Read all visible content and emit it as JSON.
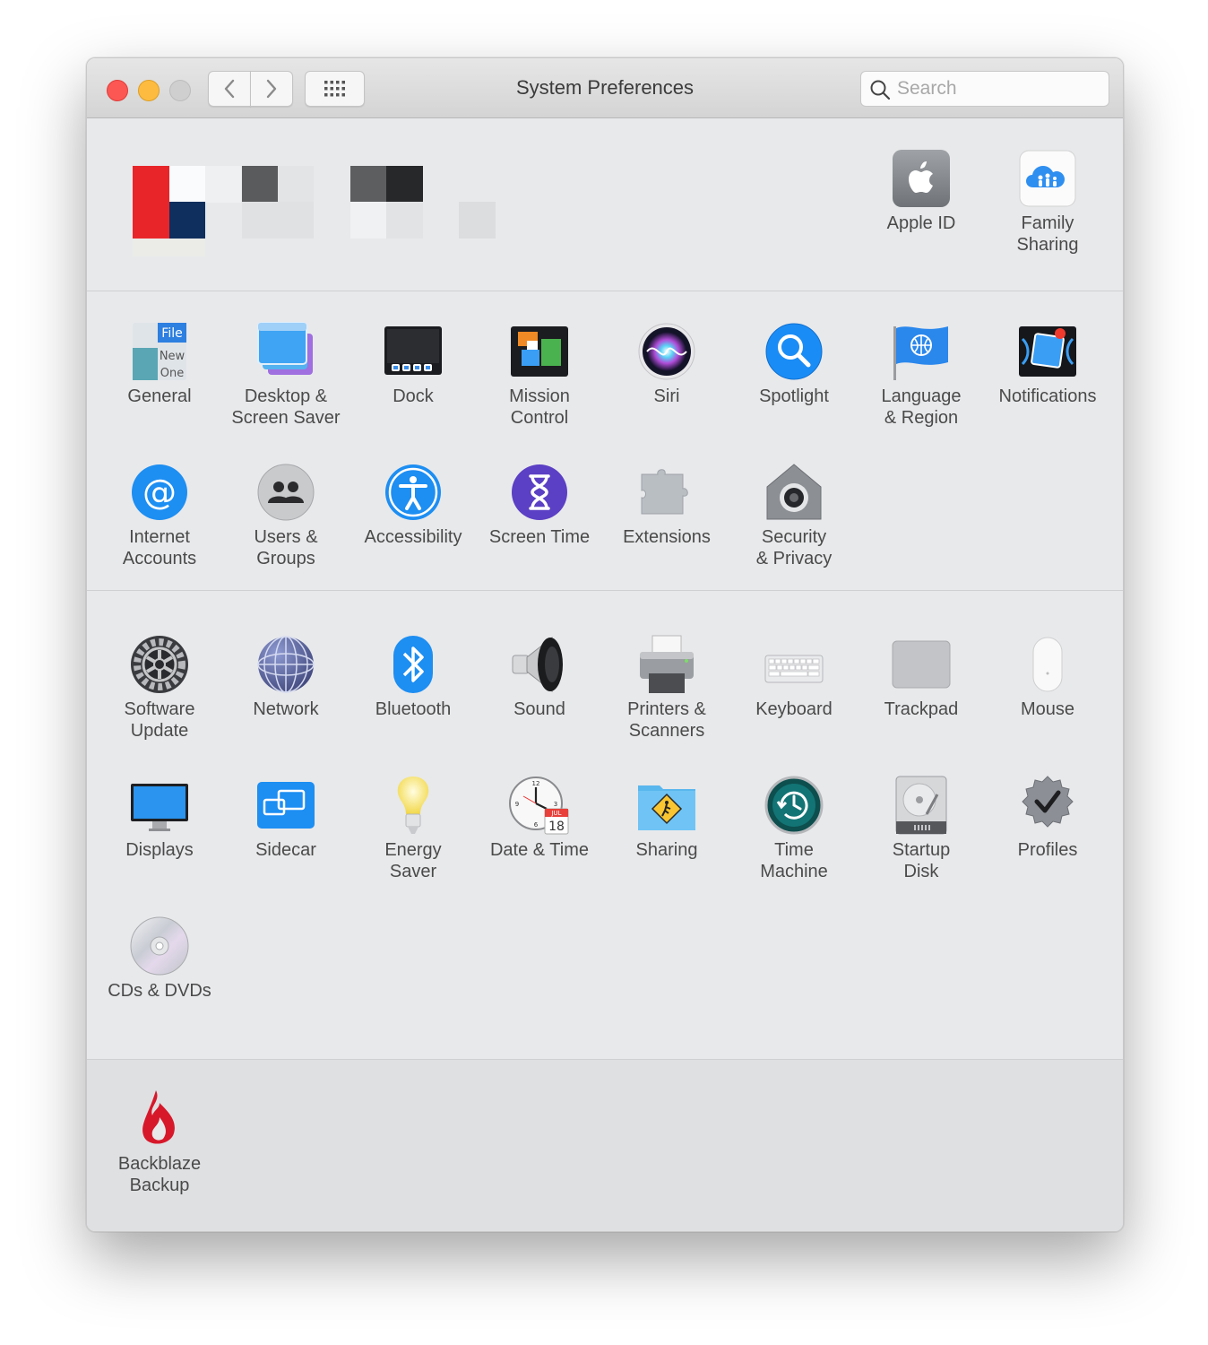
{
  "window": {
    "title": "System Preferences"
  },
  "search": {
    "placeholder": "Search"
  },
  "account": [
    {
      "id": "apple-id",
      "label": "Apple ID",
      "icon": "apple-icon"
    },
    {
      "id": "family-sharing",
      "label": "Family\nSharing",
      "icon": "family-cloud-icon"
    }
  ],
  "row1": [
    {
      "label": "General",
      "icon": "general-icon"
    },
    {
      "label": "Desktop &\nScreen Saver",
      "icon": "desktop-icon"
    },
    {
      "label": "Dock",
      "icon": "dock-icon"
    },
    {
      "label": "Mission\nControl",
      "icon": "mission-control-icon"
    },
    {
      "label": "Siri",
      "icon": "siri-icon"
    },
    {
      "label": "Spotlight",
      "icon": "spotlight-icon"
    },
    {
      "label": "Language\n& Region",
      "icon": "language-flag-icon"
    },
    {
      "label": "Notifications",
      "icon": "notifications-icon"
    }
  ],
  "row2": [
    {
      "label": "Internet\nAccounts",
      "icon": "at-sign-icon"
    },
    {
      "label": "Users &\nGroups",
      "icon": "users-icon"
    },
    {
      "label": "Accessibility",
      "icon": "accessibility-icon"
    },
    {
      "label": "Screen Time",
      "icon": "hourglass-icon"
    },
    {
      "label": "Extensions",
      "icon": "puzzle-icon"
    },
    {
      "label": "Security\n& Privacy",
      "icon": "security-house-icon"
    }
  ],
  "row3": [
    {
      "label": "Software\nUpdate",
      "icon": "gear-icon"
    },
    {
      "label": "Network",
      "icon": "globe-icon"
    },
    {
      "label": "Bluetooth",
      "icon": "bluetooth-icon"
    },
    {
      "label": "Sound",
      "icon": "speaker-icon"
    },
    {
      "label": "Printers &\nScanners",
      "icon": "printer-icon"
    },
    {
      "label": "Keyboard",
      "icon": "keyboard-icon"
    },
    {
      "label": "Trackpad",
      "icon": "trackpad-icon"
    },
    {
      "label": "Mouse",
      "icon": "mouse-icon"
    }
  ],
  "row4": [
    {
      "label": "Displays",
      "icon": "display-icon"
    },
    {
      "label": "Sidecar",
      "icon": "sidecar-icon"
    },
    {
      "label": "Energy\nSaver",
      "icon": "lightbulb-icon"
    },
    {
      "label": "Date & Time",
      "icon": "clock-icon",
      "calendar_month": "JUL",
      "calendar_day": "18"
    },
    {
      "label": "Sharing",
      "icon": "sharing-folder-icon"
    },
    {
      "label": "Time\nMachine",
      "icon": "time-machine-icon"
    },
    {
      "label": "Startup\nDisk",
      "icon": "hard-disk-icon"
    },
    {
      "label": "Profiles",
      "icon": "profiles-badge-icon"
    }
  ],
  "row5": [
    {
      "label": "CDs & DVDs",
      "icon": "disc-icon"
    }
  ],
  "third_party": [
    {
      "label": "Backblaze\nBackup",
      "icon": "backblaze-flame-icon"
    }
  ],
  "colors": {
    "close": "#fc5753",
    "minimize": "#fdbc40",
    "window_bg": "#e8e9eb",
    "third_party_bg": "#dfe0e2"
  }
}
